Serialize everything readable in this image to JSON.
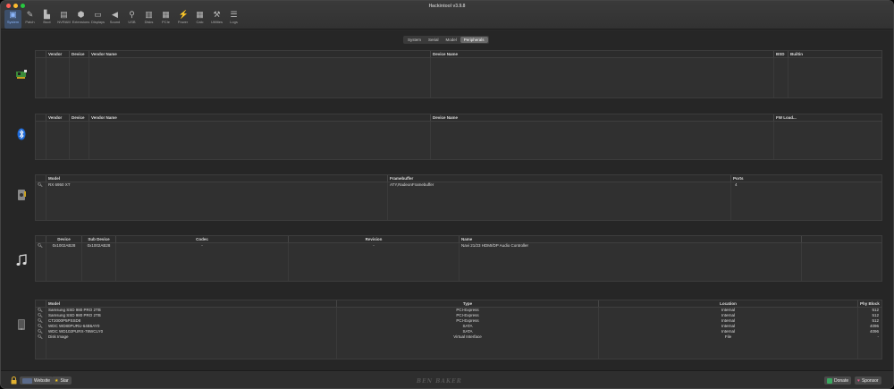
{
  "window": {
    "title": "Hackintool v3.9.8"
  },
  "toolbar": [
    {
      "label": "System",
      "icon": "system-icon",
      "glyph": "▣",
      "active": true
    },
    {
      "label": "Patch",
      "icon": "patch-icon",
      "glyph": "✎",
      "active": false
    },
    {
      "label": "Boot",
      "icon": "boot-icon",
      "glyph": "▙",
      "active": false
    },
    {
      "label": "NVRAM",
      "icon": "nvram-icon",
      "glyph": "▤",
      "active": false
    },
    {
      "label": "Extensions",
      "icon": "extensions-icon",
      "glyph": "⬢",
      "active": false
    },
    {
      "label": "Displays",
      "icon": "displays-icon",
      "glyph": "▭",
      "active": false
    },
    {
      "label": "Sound",
      "icon": "sound-icon",
      "glyph": "◀",
      "active": false
    },
    {
      "label": "USB",
      "icon": "usb-icon",
      "glyph": "⚲",
      "active": false
    },
    {
      "label": "Disks",
      "icon": "disks-icon",
      "glyph": "▥",
      "active": false
    },
    {
      "label": "PCIe",
      "icon": "pcie-icon",
      "glyph": "▦",
      "active": false
    },
    {
      "label": "Power",
      "icon": "power-icon",
      "glyph": "⚡",
      "active": false
    },
    {
      "label": "Calc",
      "icon": "calc-icon",
      "glyph": "▦",
      "active": false
    },
    {
      "label": "Utilities",
      "icon": "utilities-icon",
      "glyph": "⚒",
      "active": false
    },
    {
      "label": "Logs",
      "icon": "logs-icon",
      "glyph": "☰",
      "active": false
    }
  ],
  "tabs": [
    "System",
    "Serial",
    "Model",
    "Peripherals"
  ],
  "active_tab": "Peripherals",
  "network": {
    "headers": [
      "Vendor",
      "Device",
      "Vendor Name",
      "Device Name",
      "BSD",
      "Builtin"
    ]
  },
  "bluetooth": {
    "headers": [
      "Vendor",
      "Device",
      "Vendor Name",
      "Device Name",
      "FW Load..."
    ]
  },
  "graphics": {
    "headers": [
      "Model",
      "Framebuffer",
      "Ports"
    ],
    "rows": [
      {
        "model": "RX 6950 XT",
        "framebuffer": "ATY,RadeonFramebuffer",
        "ports": "4"
      }
    ]
  },
  "audio": {
    "headers": [
      "Device",
      "Sub Device",
      "Codec",
      "Revision",
      "Name"
    ],
    "rows": [
      {
        "device": "0x1002AB28",
        "sub_device": "0x1002AB28",
        "codec": "-",
        "revision": "-",
        "name": "Navi 21/23 HDMI/DP Audio Controller"
      }
    ]
  },
  "storage": {
    "headers": [
      "Model",
      "Type",
      "Location",
      "Phy Block"
    ],
    "rows": [
      {
        "model": "Samsung SSD 980 PRO 2TB",
        "type": "PCI-Express",
        "location": "Internal",
        "block": "512"
      },
      {
        "model": "Samsung SSD 980 PRO 2TB",
        "type": "PCI-Express",
        "location": "Internal",
        "block": "512"
      },
      {
        "model": "CT2000P5PSSD8",
        "type": "PCI-Express",
        "location": "Internal",
        "block": "512"
      },
      {
        "model": "WDC WD80PURU-64B6AY0",
        "type": "SATA",
        "location": "Internal",
        "block": "4096"
      },
      {
        "model": "WDC WD102PURX-78WCLY0",
        "type": "SATA",
        "location": "Internal",
        "block": "4096"
      },
      {
        "model": "Disk Image",
        "type": "Virtual Interface",
        "location": "File",
        "block": "-"
      }
    ]
  },
  "footer": {
    "website_label": "Website",
    "star_label": "Star",
    "logo_text": "BEN BAKER",
    "donate_label": "Donate",
    "sponsor_label": "Sponsor"
  }
}
